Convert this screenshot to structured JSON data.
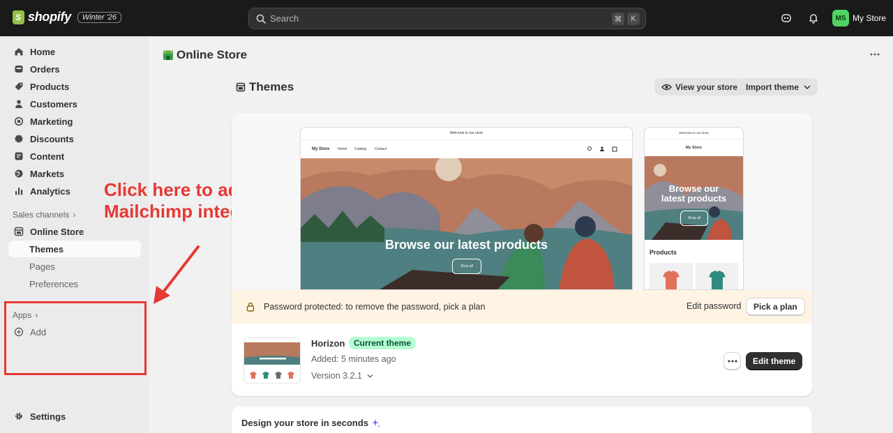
{
  "topbar": {
    "brand": "shopify",
    "edition": "Winter '26",
    "search_placeholder": "Search",
    "shortcut_cmd": "⌘",
    "shortcut_key": "K",
    "avatar_initials": "MS",
    "store_name": "My Store"
  },
  "sidebar": {
    "items": [
      {
        "label": "Home",
        "icon": "home-icon"
      },
      {
        "label": "Orders",
        "icon": "orders-icon"
      },
      {
        "label": "Products",
        "icon": "tag-icon"
      },
      {
        "label": "Customers",
        "icon": "person-icon"
      },
      {
        "label": "Marketing",
        "icon": "target-icon"
      },
      {
        "label": "Discounts",
        "icon": "discount-icon"
      },
      {
        "label": "Content",
        "icon": "content-icon"
      },
      {
        "label": "Markets",
        "icon": "globe-icon"
      },
      {
        "label": "Analytics",
        "icon": "chart-icon"
      }
    ],
    "sales_channels_label": "Sales channels",
    "online_store_label": "Online Store",
    "sub_items": [
      "Themes",
      "Pages",
      "Preferences"
    ],
    "apps_label": "Apps",
    "add_label": "Add",
    "settings_label": "Settings"
  },
  "annotation": {
    "line1": "Click here to add",
    "line2": "Mailchimp integration"
  },
  "main": {
    "page_title": "Online Store",
    "section_title": "Themes",
    "view_store_label": "View your store",
    "import_theme_label": "Import theme",
    "preview": {
      "announcement": "Welcome to our store",
      "store_name": "My Store",
      "nav": [
        "Home",
        "Catalog",
        "Contact"
      ],
      "hero_title": "Browse our latest products",
      "hero_button": "Shop all",
      "mobile_hero_line1": "Browse our",
      "mobile_hero_line2": "latest products",
      "products_heading": "Products"
    },
    "password_text": "Password protected: to remove the password, pick a plan",
    "edit_password_label": "Edit password",
    "pick_plan_label": "Pick a plan",
    "theme": {
      "name": "Horizon",
      "status": "Current theme",
      "added": "Added: 5 minutes ago",
      "version": "Version 3.2.1",
      "edit_label": "Edit theme"
    },
    "design_card_title": "Design your store in seconds"
  },
  "colors": {
    "topbar_bg": "#1a1a1a",
    "sidebar_bg": "#ebebeb",
    "annotation_red": "#e53935",
    "current_theme_green": "#b4fed2",
    "password_banner": "#fff4e4"
  }
}
